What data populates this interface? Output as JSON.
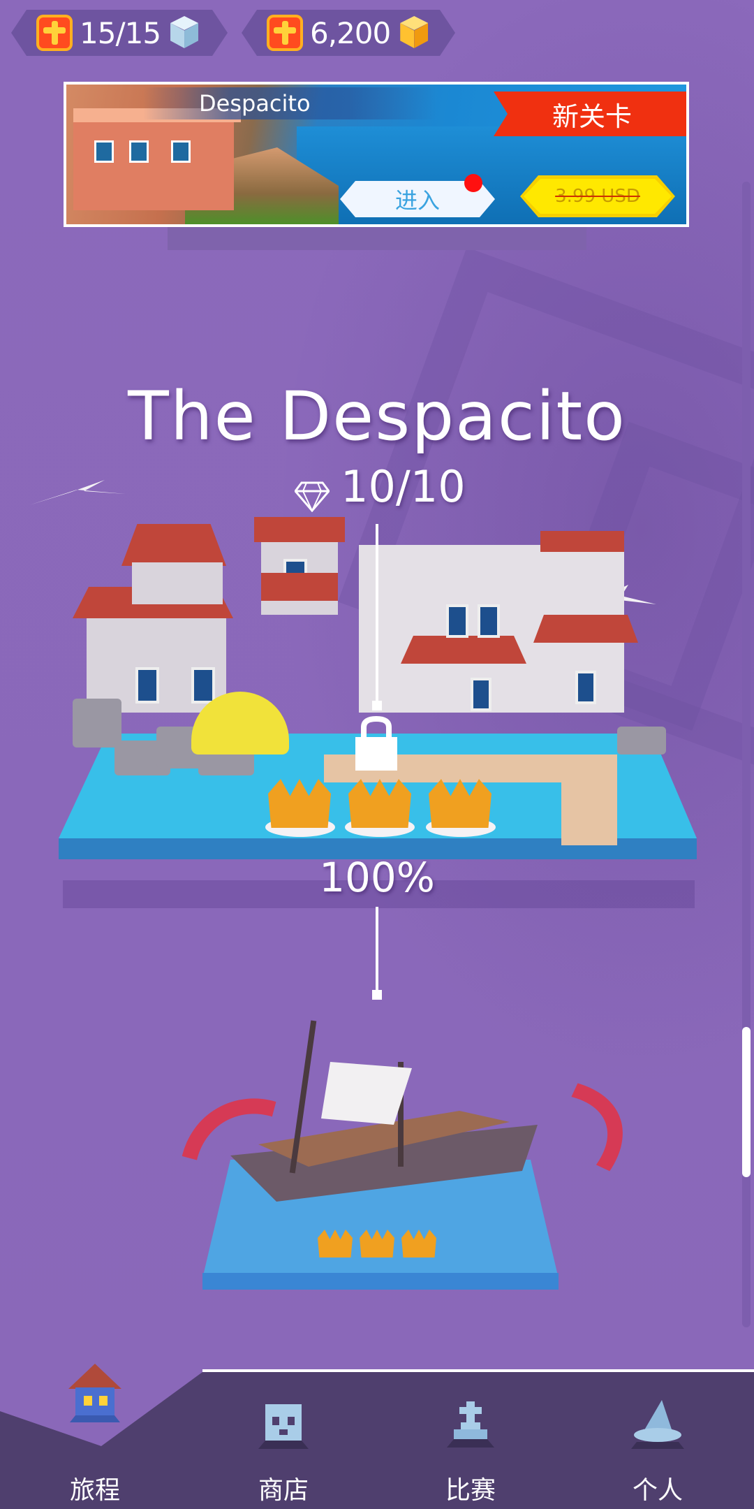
{
  "currency": {
    "energy": "15/15",
    "gems": "6,200"
  },
  "banner": {
    "title": "Despacito",
    "ribbon": "新关卡",
    "enter_label": "进入",
    "price": "3.99 USD"
  },
  "level": {
    "title": "The Despacito",
    "gems": "10/10",
    "progress": "100%"
  },
  "icons": {
    "energy_icon": "ice-cube-icon",
    "gem_icon": "gold-cube-icon",
    "add_icon": "plus-icon"
  },
  "nav": {
    "items": [
      {
        "label": "旅程",
        "icon": "house-icon"
      },
      {
        "label": "商店",
        "icon": "skull-cube-icon"
      },
      {
        "label": "比赛",
        "icon": "trophy-icon"
      },
      {
        "label": "个人",
        "icon": "wizard-hat-icon"
      }
    ]
  },
  "colors": {
    "background": "#8a68b9",
    "ribbon": "#f03010",
    "price_button": "#ffe800",
    "water": "#38bfe9"
  }
}
